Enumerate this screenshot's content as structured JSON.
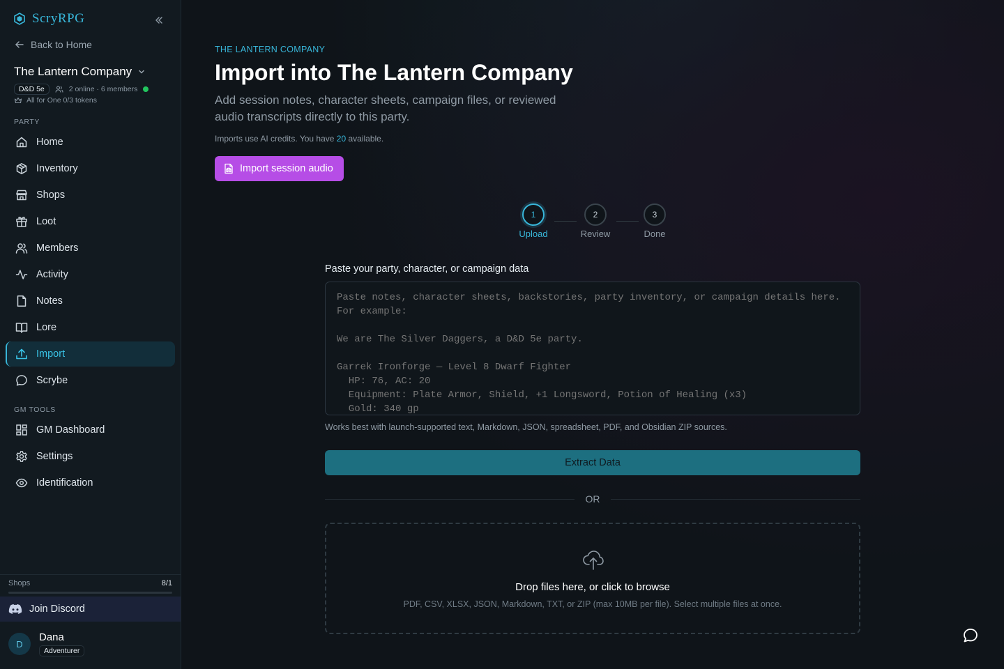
{
  "brand": {
    "name": "ScryRPG",
    "accent": "#38b6d9"
  },
  "sidebar": {
    "back_label": "Back to Home",
    "party_name": "The Lantern Company",
    "system_badge": "D&D 5e",
    "presence": "2 online · 6 members",
    "tokens": "All for One 0/3 tokens",
    "party_section": "PARTY",
    "items": [
      {
        "label": "Home",
        "icon": "home-icon"
      },
      {
        "label": "Inventory",
        "icon": "box-icon"
      },
      {
        "label": "Shops",
        "icon": "store-icon"
      },
      {
        "label": "Loot",
        "icon": "gift-icon"
      },
      {
        "label": "Members",
        "icon": "users-icon"
      },
      {
        "label": "Activity",
        "icon": "activity-icon"
      },
      {
        "label": "Notes",
        "icon": "file-icon"
      },
      {
        "label": "Lore",
        "icon": "book-icon"
      },
      {
        "label": "Import",
        "icon": "upload-icon",
        "active": true
      },
      {
        "label": "Scrybe",
        "icon": "chat-icon"
      }
    ],
    "gm_section": "GM TOOLS",
    "gm_items": [
      {
        "label": "GM Dashboard",
        "icon": "dashboard-icon"
      },
      {
        "label": "Settings",
        "icon": "gear-icon"
      },
      {
        "label": "Identification",
        "icon": "eye-icon"
      }
    ],
    "usage": {
      "label": "Shops",
      "count": "8/1"
    },
    "discord_label": "Join Discord",
    "user": {
      "initial": "D",
      "name": "Dana",
      "role": "Adventurer"
    }
  },
  "main": {
    "eyebrow": "THE LANTERN COMPANY",
    "title": "Import into The Lantern Company",
    "subtitle": "Add session notes, character sheets, campaign files, or reviewed audio transcripts directly to this party.",
    "credits_prefix": "Imports use AI credits. You have ",
    "credits_count": "20",
    "credits_suffix": " available.",
    "audio_button": "Import session audio",
    "steps": [
      {
        "number": "1",
        "label": "Upload",
        "active": true
      },
      {
        "number": "2",
        "label": "Review",
        "active": false
      },
      {
        "number": "3",
        "label": "Done",
        "active": false
      }
    ],
    "paste_label": "Paste your party, character, or campaign data",
    "textarea_value": "",
    "textarea_placeholder": "Paste notes, character sheets, backstories, party inventory, or campaign details here.\nFor example:\n\nWe are The Silver Daggers, a D&D 5e party.\n\nGarrek Ironforge — Level 8 Dwarf Fighter\n  HP: 76, AC: 20\n  Equipment: Plate Armor, Shield, +1 Longsword, Potion of Healing (x3)\n  Gold: 340 gp",
    "hint": "Works best with launch-supported text, Markdown, JSON, spreadsheet, PDF, and Obsidian ZIP sources.",
    "extract_button": "Extract Data",
    "or_text": "OR",
    "dropzone": {
      "title": "Drop files here, or click to browse",
      "subtitle": "PDF, CSV, XLSX, JSON, Markdown, TXT, or ZIP (max 10MB per file). Select multiple files at once."
    }
  },
  "colors": {
    "accent": "#38b6d9",
    "audio_button": "#b64de6",
    "extract_button": "#1d6f80",
    "online": "#22c55e"
  }
}
